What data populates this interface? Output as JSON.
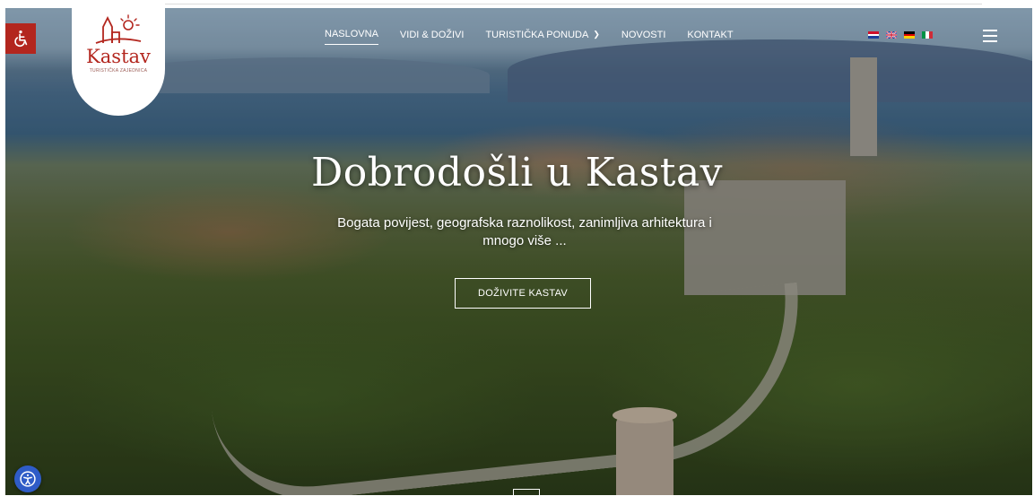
{
  "logo": {
    "name": "Kastav",
    "subtitle": "TURISTIČKA ZAJEDNICA"
  },
  "nav": {
    "items": [
      {
        "label": "NASLOVNA",
        "active": true
      },
      {
        "label": "VIDI & DOŽIVI",
        "active": false
      },
      {
        "label": "TURISTIČKA PONUDA",
        "active": false,
        "has_dropdown": true
      },
      {
        "label": "NOVOSTI",
        "active": false
      },
      {
        "label": "KONTAKT",
        "active": false
      }
    ],
    "languages": [
      "hr-flag-icon",
      "uk-flag-icon",
      "de-flag-icon",
      "it-flag-icon"
    ],
    "menu_icon": "hamburger-menu-icon"
  },
  "hero": {
    "title": "Dobrodošli u Kastav",
    "subtitle": "Bogata povijest, geografska raznolikost, zanimljiva arhitektura i mnogo više ...",
    "cta_label": "DOŽIVITE KASTAV"
  },
  "accessibility": {
    "top_icon": "wheelchair-icon",
    "bottom_icon": "accessibility-icon"
  },
  "colors": {
    "brand_red": "#b3261e",
    "accessibility_blue": "#2f5cc7"
  }
}
